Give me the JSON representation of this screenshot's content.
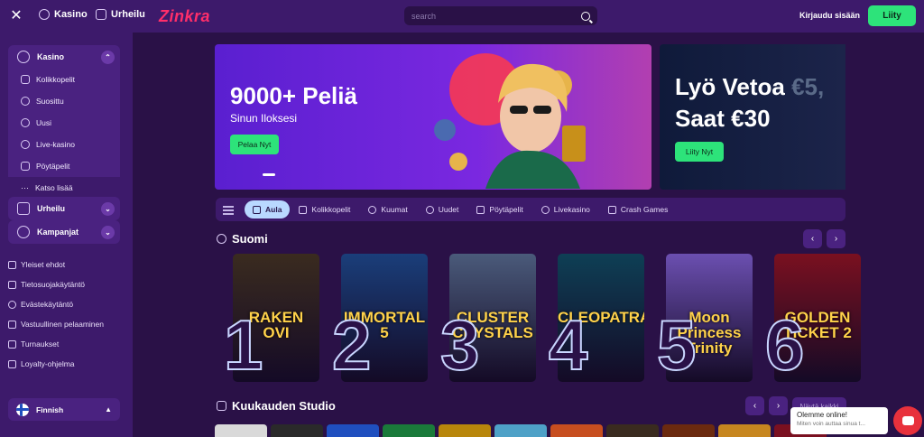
{
  "header": {
    "nav": [
      {
        "label": "Kasino"
      },
      {
        "label": "Urheilu"
      }
    ],
    "logo": "Zinkra",
    "search_placeholder": "search",
    "login": "Kirjaudu sisään",
    "join": "Liity"
  },
  "sidebar": {
    "casino": {
      "label": "Kasino",
      "items": [
        {
          "label": "Kolikkopelit",
          "icon": "slot-icon"
        },
        {
          "label": "Suosittu",
          "icon": "star-icon"
        },
        {
          "label": "Uusi",
          "icon": "new-icon"
        },
        {
          "label": "Live-kasino",
          "icon": "live-icon"
        },
        {
          "label": "Pöytäpelit",
          "icon": "table-icon"
        },
        {
          "label": "Katso lisää",
          "icon": "more-icon"
        }
      ]
    },
    "sports": {
      "label": "Urheilu"
    },
    "promos": {
      "label": "Kampanjat"
    },
    "links": [
      {
        "label": "Yleiset ehdot"
      },
      {
        "label": "Tietosuojakäytäntö"
      },
      {
        "label": "Evästekäytäntö"
      },
      {
        "label": "Vastuullinen pelaaminen"
      },
      {
        "label": "Turnaukset"
      },
      {
        "label": "Loyalty-ohjelma"
      }
    ],
    "language": "Finnish"
  },
  "banners": [
    {
      "title": "9000+ Peliä",
      "subtitle": "Sinun Iloksesi",
      "cta": "Pelaa Nyt"
    },
    {
      "title_line1": "Lyö Vetoa",
      "title_line1_dim": "€5,",
      "title_line2": "Saat €30",
      "cta": "Liity Nyt"
    }
  ],
  "categories": [
    {
      "label": "Aula",
      "active": true
    },
    {
      "label": "Kolikkopelit"
    },
    {
      "label": "Kuumat"
    },
    {
      "label": "Uudet"
    },
    {
      "label": "Pöytäpelit"
    },
    {
      "label": "Livekasino"
    },
    {
      "label": "Crash Games"
    }
  ],
  "section_top": {
    "title": "Suomi",
    "games": [
      {
        "rank": "1",
        "title": "RAKEN\nOVI",
        "bg": "#3a2b1f"
      },
      {
        "rank": "2",
        "title": "IMMORTAL\n5",
        "bg": "#1a3e7a"
      },
      {
        "rank": "3",
        "title": "CLUSTER\nCRYSTALS",
        "bg": "#4a5a7a"
      },
      {
        "rank": "4",
        "title": "CLEOPATRA",
        "bg": "#0e3f55"
      },
      {
        "rank": "5",
        "title": "Moon Princess\nTrinity",
        "bg": "#6b4fb0"
      },
      {
        "rank": "6",
        "title": "GOLDEN\nTICKET 2",
        "bg": "#7a1020"
      }
    ]
  },
  "section_studio": {
    "title": "Kuukauden Studio",
    "see_all": "Näytä kaikki",
    "tiles": [
      "#d9d9d9",
      "#2a2a2a",
      "#1f4fbf",
      "#1a7a3a",
      "#b8860b",
      "#4ea1c7",
      "#c74e1f",
      "#3a2b1f",
      "#6b2a0f",
      "#c7861f",
      "#7a1020"
    ]
  },
  "chat": {
    "title": "Olemme online!",
    "subtitle": "Miten voin auttaa sinua t..."
  }
}
